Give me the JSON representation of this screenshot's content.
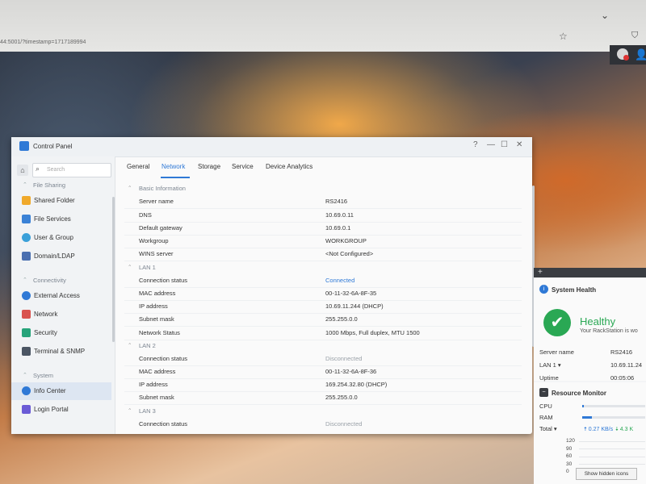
{
  "browser": {
    "url": "44:5001/?timestamp=1717189994",
    "star_icon": "star-icon",
    "pocket_icon": "pocket-icon"
  },
  "control_panel": {
    "title": "Control Panel",
    "window_controls": {
      "help": "?",
      "minimize": "—",
      "maximize": "☐",
      "close": "✕"
    },
    "search_placeholder": "Search",
    "sidebar": {
      "sections": [
        {
          "label": "File Sharing",
          "items": [
            "Shared Folder",
            "File Services",
            "User & Group",
            "Domain/LDAP"
          ]
        },
        {
          "label": "Connectivity",
          "items": [
            "External Access",
            "Network",
            "Security",
            "Terminal & SNMP"
          ]
        },
        {
          "label": "System",
          "items": [
            "Info Center",
            "Login Portal"
          ]
        }
      ],
      "active_item": "Info Center"
    },
    "tabs": [
      "General",
      "Network",
      "Storage",
      "Service",
      "Device Analytics"
    ],
    "active_tab": "Network",
    "sections": [
      {
        "title": "Basic Information",
        "rows": [
          {
            "label": "Server name",
            "value": "RS2416"
          },
          {
            "label": "DNS",
            "value": "10.69.0.11"
          },
          {
            "label": "Default gateway",
            "value": "10.69.0.1"
          },
          {
            "label": "Workgroup",
            "value": "WORKGROUP"
          },
          {
            "label": "WINS server",
            "value": "<Not Configured>"
          }
        ]
      },
      {
        "title": "LAN 1",
        "rows": [
          {
            "label": "Connection status",
            "value": "Connected"
          },
          {
            "label": "MAC address",
            "value": "00-11-32-6A-8F-35"
          },
          {
            "label": "IP address",
            "value": "10.69.11.244 (DHCP)"
          },
          {
            "label": "Subnet mask",
            "value": "255.255.0.0"
          },
          {
            "label": "Network Status",
            "value": "1000 Mbps, Full duplex, MTU 1500"
          }
        ]
      },
      {
        "title": "LAN 2",
        "rows": [
          {
            "label": "Connection status",
            "value": "Disconnected"
          },
          {
            "label": "MAC address",
            "value": "00-11-32-6A-8F-36"
          },
          {
            "label": "IP address",
            "value": "169.254.32.80 (DHCP)"
          },
          {
            "label": "Subnet mask",
            "value": "255.255.0.0"
          }
        ]
      },
      {
        "title": "LAN 3",
        "rows": [
          {
            "label": "Connection status",
            "value": "Disconnected"
          }
        ]
      }
    ]
  },
  "system_health": {
    "title": "System Health",
    "status": "Healthy",
    "subtitle": "Your RackStation is wo",
    "rows": [
      {
        "label": "Server name",
        "value": "RS2416"
      },
      {
        "label": "LAN 1 ▾",
        "value": "10.69.11.24"
      },
      {
        "label": "Uptime",
        "value": "00:05:06"
      }
    ]
  },
  "resource_monitor": {
    "title": "Resource Monitor",
    "cpu_label": "CPU",
    "ram_label": "RAM",
    "total_label": "Total ▾",
    "cpu_percent": 3,
    "ram_percent": 15,
    "upload": "🠅 0.27 KB/s",
    "download": "🠇 4.3 K",
    "ticks": [
      "120",
      "90",
      "60",
      "30",
      "0"
    ]
  },
  "tooltip": "Show hidden icons",
  "colors": {
    "accent": "#2f79d6",
    "healthy": "#2aa854"
  }
}
